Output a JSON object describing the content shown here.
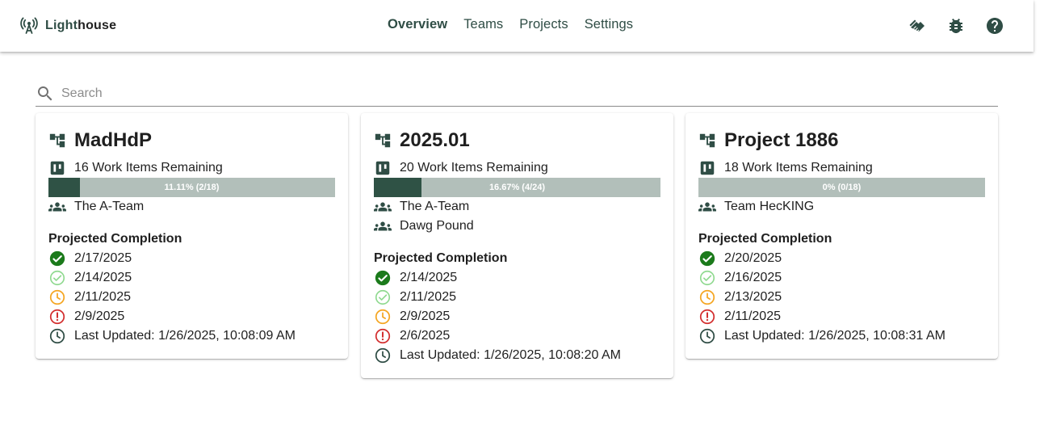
{
  "brand": {
    "name_part1": "Light",
    "name_part2": "house"
  },
  "nav": {
    "items": [
      "Overview",
      "Teams",
      "Projects",
      "Settings"
    ],
    "active": "Overview"
  },
  "search": {
    "placeholder": "Search",
    "value": ""
  },
  "colors": {
    "primary": "#2f5245",
    "progress_track": "#b2bfba",
    "ok_dark": "#1b7a1b",
    "ok_light": "#8fd98f",
    "warning": "#f5a623",
    "danger": "#d32f2f"
  },
  "cards": [
    {
      "title": "MadHdP",
      "work_items": "16 Work Items Remaining",
      "progress": {
        "label": "11.11% (2/18)",
        "fraction": 0.1111
      },
      "teams": [
        "The A-Team"
      ],
      "projected_title": "Projected Completion",
      "forecasts": [
        "2/17/2025",
        "2/14/2025",
        "2/11/2025",
        "2/9/2025"
      ],
      "last_updated": "Last Updated: 1/26/2025, 10:08:09 AM"
    },
    {
      "title": "2025.01",
      "work_items": "20 Work Items Remaining",
      "progress": {
        "label": "16.67% (4/24)",
        "fraction": 0.1667
      },
      "teams": [
        "The A-Team",
        "Dawg Pound"
      ],
      "projected_title": "Projected Completion",
      "forecasts": [
        "2/14/2025",
        "2/11/2025",
        "2/9/2025",
        "2/6/2025"
      ],
      "last_updated": "Last Updated: 1/26/2025, 10:08:20 AM"
    },
    {
      "title": "Project 1886",
      "work_items": "18 Work Items Remaining",
      "progress": {
        "label": "0% (0/18)",
        "fraction": 0
      },
      "teams": [
        "Team HecKING"
      ],
      "projected_title": "Projected Completion",
      "forecasts": [
        "2/20/2025",
        "2/16/2025",
        "2/13/2025",
        "2/11/2025"
      ],
      "last_updated": "Last Updated: 1/26/2025, 10:08:31 AM"
    }
  ]
}
